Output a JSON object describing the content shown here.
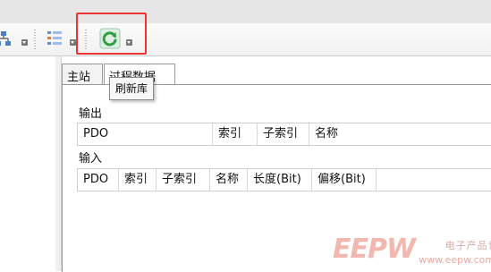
{
  "toolbar": {
    "buttons": [
      {
        "icon": "network-icon",
        "name": "network"
      },
      {
        "icon": "list-icon",
        "name": "list"
      },
      {
        "icon": "refresh-icon",
        "name": "refresh-library"
      }
    ]
  },
  "tooltip": {
    "text": "刷新库"
  },
  "tabs": [
    {
      "label": "主站",
      "active": false
    },
    {
      "label": "过程数据",
      "active": true
    }
  ],
  "output": {
    "label": "输出",
    "columns": [
      "PDO",
      "索引",
      "子索引",
      "名称"
    ]
  },
  "input": {
    "label": "输入",
    "columns": [
      "PDO",
      "索引",
      "子索引",
      "名称",
      "长度(Bit)",
      "偏移(Bit)"
    ]
  },
  "watermark": {
    "logo": "EEPW",
    "subtitle": "电子产品世界",
    "url": "www.eepw.com.cn"
  },
  "colors": {
    "highlight_box": "#e33333",
    "refresh_green": "#2ea043"
  }
}
